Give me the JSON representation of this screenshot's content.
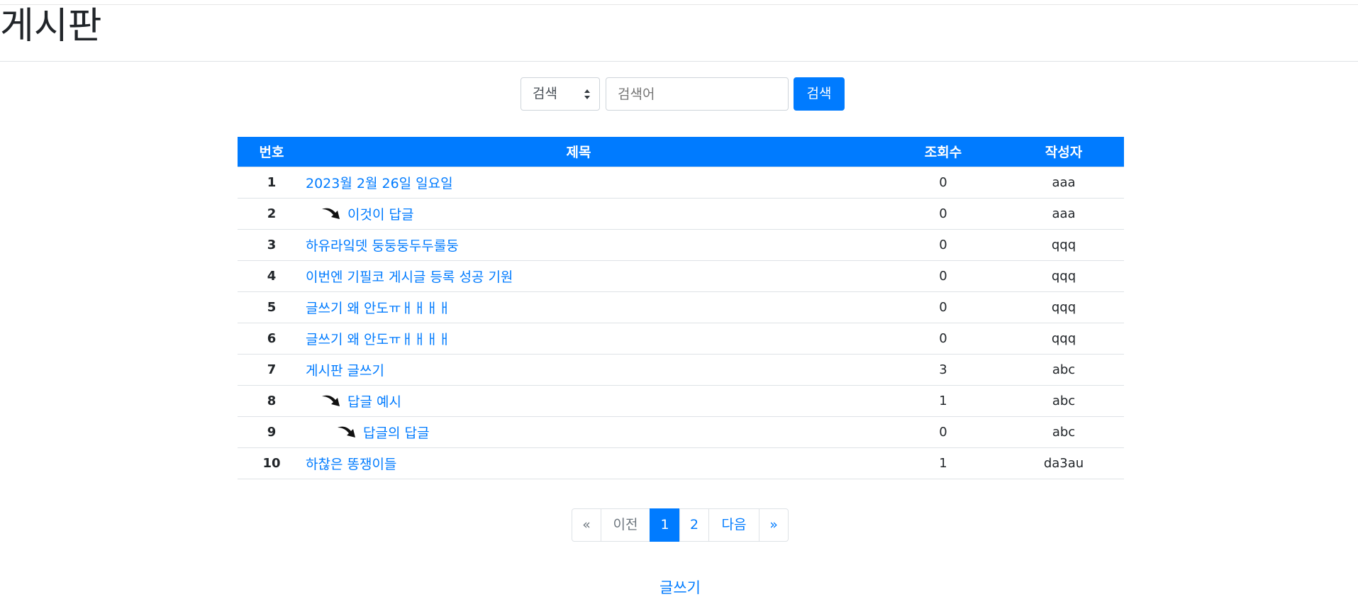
{
  "page": {
    "title": "게시판"
  },
  "search": {
    "select_value": "검색",
    "placeholder": "검색어",
    "button_label": "검색"
  },
  "table": {
    "headers": {
      "no": "번호",
      "title": "제목",
      "views": "조회수",
      "author": "작성자"
    },
    "rows": [
      {
        "no": "1",
        "title": "2023월 2월 26일 일요일",
        "views": "0",
        "author": "aaa",
        "depth": 0
      },
      {
        "no": "2",
        "title": "이것이 답글",
        "views": "0",
        "author": "aaa",
        "depth": 1
      },
      {
        "no": "3",
        "title": "하유라잌뎃 둥둥둥두두룰둥",
        "views": "0",
        "author": "qqq",
        "depth": 0
      },
      {
        "no": "4",
        "title": "이번엔 기필코 게시글 등록 성공 기원",
        "views": "0",
        "author": "qqq",
        "depth": 0
      },
      {
        "no": "5",
        "title": "글쓰기 왜 안도ㅠㅐㅐㅐㅐ",
        "views": "0",
        "author": "qqq",
        "depth": 0
      },
      {
        "no": "6",
        "title": "글쓰기 왜 안도ㅠㅐㅐㅐㅐ",
        "views": "0",
        "author": "qqq",
        "depth": 0
      },
      {
        "no": "7",
        "title": "게시판 글쓰기",
        "views": "3",
        "author": "abc",
        "depth": 0
      },
      {
        "no": "8",
        "title": "답글 예시",
        "views": "1",
        "author": "abc",
        "depth": 1
      },
      {
        "no": "9",
        "title": "답글의 답글",
        "views": "0",
        "author": "abc",
        "depth": 2
      },
      {
        "no": "10",
        "title": "하찮은 똥쟁이들",
        "views": "1",
        "author": "da3au",
        "depth": 0
      }
    ]
  },
  "pagination": {
    "first": "«",
    "prev": "이전",
    "pages": [
      "1",
      "2"
    ],
    "active_page": "1",
    "next": "다음",
    "last": "»"
  },
  "write_link": "글쓰기",
  "colors": {
    "primary": "#007bff",
    "border": "#dee2e6"
  },
  "icons": {
    "reply": "reply-arrow-icon",
    "select": "sort-arrows-icon"
  }
}
